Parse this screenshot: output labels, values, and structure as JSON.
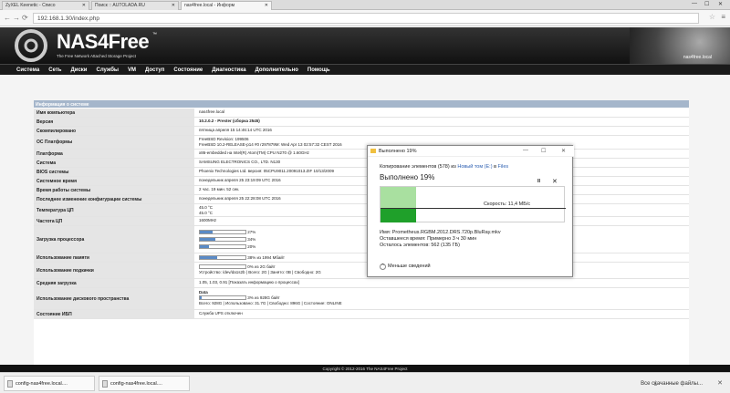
{
  "browser": {
    "tabs": [
      "ZyXEL Keenetic - Списо",
      "Поиск :: AUTOLADA.RU",
      "nas4free.local - Информ"
    ],
    "url": "192.168.1.30/index.php",
    "back": "←",
    "forward": "→",
    "reload": "⟳"
  },
  "header": {
    "logo": "NAS4Free",
    "tm": "™",
    "subtitle": "The Free Network Attached Storage Project",
    "hostname": "nas4free.local"
  },
  "menu": [
    "Система",
    "Сеть",
    "Диски",
    "Службы",
    "VM",
    "Доступ",
    "Состояние",
    "Диагностика",
    "Дополнительно",
    "Помощь"
  ],
  "info": {
    "heading": "Информация о системе",
    "rows": [
      {
        "label": "Имя компьютера",
        "value": "nas4free.local"
      },
      {
        "label": "Версия",
        "value": "10.2.0.2 - Prester (сборка 2545)"
      },
      {
        "label": "Скомпилировано",
        "value": "пятница апреля 15 14:46:14 UTC 2016"
      },
      {
        "label": "ОС Платформы",
        "value": "FreeBSD Revision: 199506",
        "value2": "FreeBSD 10.2-RELEASE-p14 #0 r297879M: Wed Apr 13 02:57:32 CEST 2016"
      },
      {
        "label": "Платформа",
        "value": "x86-embedded на Intel(R) Atom(TM) CPU N270 @ 1.60GHz"
      },
      {
        "label": "Система",
        "value": "SAMSUNG ELECTRONICS CO., LTD. N130"
      },
      {
        "label": "BIOS системы",
        "value": "Phoenix Technologies Ltd. версия: 05CPU9011.20091013.ZIF 10/13/2009"
      },
      {
        "label": "Системное время",
        "value": "понедельник апреля 25 23:19:09 UTC 2016"
      },
      {
        "label": "Время работы системы",
        "value": "2 час. 19 мин. 52 сек."
      },
      {
        "label": "Последнее изменение конфигурации системы",
        "value": "понедельник апреля 25 22:28:08 UTC 2016"
      },
      {
        "label": "Температура ЦП",
        "value": "45.0 °C",
        "value2": "45.0 °C"
      },
      {
        "label": "Частота ЦП",
        "value": "1600MHz"
      },
      {
        "label": "Загрузка процессора",
        "bars": [
          {
            "pct": 27,
            "text": "27%"
          },
          {
            "pct": 34,
            "text": "34%"
          },
          {
            "pct": 20,
            "text": "20%"
          }
        ]
      },
      {
        "label": "Использование памяти",
        "bars": [
          {
            "pct": 38,
            "text": "38% из 1994 Мбайт"
          }
        ]
      },
      {
        "label": "Использование подкачки",
        "bars": [
          {
            "pct": 0,
            "text": "0% из 2G байт"
          }
        ],
        "value2": "Устройство: /dev/da1s2b | Всего: 2G | Занято: 0B | Свободно: 2G"
      },
      {
        "label": "Средняя загрузка",
        "value": "1.05, 1.03, 0.91   [Показать информацию о процессах]"
      },
      {
        "label": "Использование дискового пространства",
        "value": "Data",
        "bars": [
          {
            "pct": 3,
            "text": "3% из 928G байт"
          }
        ],
        "value2": "Всего: 928G | Использовано: 31.7G | Свободно: 896G | Состояние: ONLINE"
      },
      {
        "label": "Состояние ИБП",
        "value": "Служба UPS отключен"
      }
    ]
  },
  "footer": "Copyright © 2012-2016 The NAS4Free Project",
  "downloads": {
    "items": [
      "config-nas4free.local....",
      "config-nas4free.local...."
    ],
    "show_all": "Все скачанные файлы..."
  },
  "dialog": {
    "title": "Выполнено 19%",
    "copy_prefix": "Копирование элементов (578) из",
    "source": "Новый том (E:)",
    "to": "в",
    "dest": "Files",
    "done": "Выполнено 19%",
    "pause": "II",
    "close": "✕",
    "speed": "Скорость: 11,4 МБ/с",
    "progress": 0.19,
    "name": "Имя: Prometheus.RGBM.2012.DRS.720p.BluRay.mkv",
    "remaining_time": "Оставшееся время: Примерно 3 ч 30 мин",
    "remaining_items": "Осталось элементов: 562 (135 ГБ)",
    "less": "Меньше сведений"
  }
}
